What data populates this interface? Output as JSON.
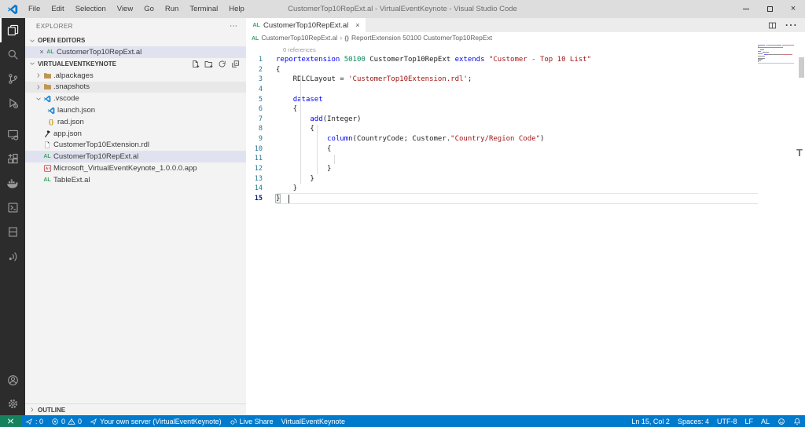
{
  "window": {
    "title": "CustomerTop10RepExt.al - VirtualEventKeynote - Visual Studio Code",
    "menus": [
      "File",
      "Edit",
      "Selection",
      "View",
      "Go",
      "Run",
      "Terminal",
      "Help"
    ],
    "controls": [
      {
        "name": "minimize-button",
        "icon": "minimize-icon"
      },
      {
        "name": "maximize-button",
        "icon": "maximize-icon"
      },
      {
        "name": "close-button",
        "icon": "close-icon"
      }
    ]
  },
  "activity_bar": {
    "top": [
      {
        "name": "explorer",
        "icon": "explorer-icon",
        "active": true
      },
      {
        "name": "search",
        "icon": "search-icon"
      },
      {
        "name": "source-control",
        "icon": "source-control-icon"
      },
      {
        "name": "run-debug",
        "icon": "run-debug-icon"
      },
      {
        "name": "remote-explorer",
        "icon": "remote-explorer-icon"
      },
      {
        "name": "extensions",
        "icon": "extensions-icon"
      },
      {
        "name": "docker",
        "icon": "docker-icon"
      },
      {
        "name": "remote-terminal",
        "icon": "terminal-box-icon"
      },
      {
        "name": "storage",
        "icon": "storage-icon"
      },
      {
        "name": "broadcast",
        "icon": "broadcast-icon"
      }
    ],
    "bottom": [
      {
        "name": "accounts",
        "icon": "account-icon"
      },
      {
        "name": "settings",
        "icon": "gear-icon"
      }
    ]
  },
  "sidebar": {
    "title": "EXPLORER",
    "title_action": "more-icon",
    "open_editors": {
      "label": "OPEN EDITORS",
      "items": [
        {
          "label": "CustomerTop10RepExt.al",
          "icon": "al",
          "selected": true
        }
      ]
    },
    "project": {
      "label": "VIRTUALEVENTKEYNOTE",
      "actions": [
        "new-file-icon",
        "new-folder-icon",
        "refresh-icon",
        "collapse-all-icon"
      ],
      "items": [
        {
          "label": ".alpackages",
          "icon": "folder",
          "type": "folder",
          "chevron": "right",
          "level": 0
        },
        {
          "label": ".snapshots",
          "icon": "folder",
          "type": "folder",
          "chevron": "right",
          "level": 0,
          "state": "hover"
        },
        {
          "label": ".vscode",
          "icon": "vscode",
          "type": "folder",
          "chevron": "down",
          "level": 0
        },
        {
          "label": "launch.json",
          "icon": "vscode",
          "type": "file",
          "level": 1
        },
        {
          "label": "rad.json",
          "icon": "braces",
          "type": "file",
          "level": 1
        },
        {
          "label": "app.json",
          "icon": "axe",
          "type": "file",
          "level": 0
        },
        {
          "label": "CustomerTop10Extension.rdl",
          "icon": "file",
          "type": "file",
          "level": 0
        },
        {
          "label": "CustomerTop10RepExt.al",
          "icon": "al",
          "type": "file",
          "level": 0,
          "state": "selected"
        },
        {
          "label": "Microsoft_VirtualEventKeynote_1.0.0.0.app",
          "icon": "app",
          "type": "file",
          "level": 0
        },
        {
          "label": "TableExt.al",
          "icon": "al",
          "type": "file",
          "level": 0
        }
      ]
    },
    "outline": {
      "label": "OUTLINE"
    }
  },
  "editor": {
    "tab": {
      "label": "CustomerTop10RepExt.al",
      "icon": "al"
    },
    "tab_actions": [
      "split-editor-icon",
      "more-icon"
    ],
    "breadcrumb": [
      {
        "icon": "al",
        "label": "CustomerTop10RepExt.al"
      },
      {
        "icon": "symbol-namespace",
        "label": "ReportExtension 50100 CustomerTop10RepExt"
      }
    ],
    "codelens": "0 references",
    "cursor": {
      "line": 15,
      "col": 2
    },
    "lines": [
      {
        "n": 1,
        "tokens": [
          {
            "t": "reportextension",
            "c": "kw"
          },
          {
            "t": " ",
            "c": "pl"
          },
          {
            "t": "50100",
            "c": "num"
          },
          {
            "t": " CustomerTop10RepExt ",
            "c": "pl"
          },
          {
            "t": "extends",
            "c": "kw"
          },
          {
            "t": " ",
            "c": "pl"
          },
          {
            "t": "\"Customer - Top 10 List\"",
            "c": "str"
          }
        ]
      },
      {
        "n": 2,
        "tokens": [
          {
            "t": "{",
            "c": "pl"
          }
        ]
      },
      {
        "n": 3,
        "tokens": [
          {
            "t": "    RDLCLayout = ",
            "c": "pl"
          },
          {
            "t": "'CustomerTop10Extension.rdl'",
            "c": "str"
          },
          {
            "t": ";",
            "c": "pl"
          }
        ]
      },
      {
        "n": 4,
        "tokens": []
      },
      {
        "n": 5,
        "tokens": [
          {
            "t": "    ",
            "c": "pl"
          },
          {
            "t": "dataset",
            "c": "kw"
          }
        ]
      },
      {
        "n": 6,
        "tokens": [
          {
            "t": "    {",
            "c": "pl"
          }
        ]
      },
      {
        "n": 7,
        "tokens": [
          {
            "t": "        ",
            "c": "pl"
          },
          {
            "t": "add",
            "c": "kw"
          },
          {
            "t": "(Integer)",
            "c": "pl"
          }
        ]
      },
      {
        "n": 8,
        "tokens": [
          {
            "t": "        {",
            "c": "pl"
          }
        ]
      },
      {
        "n": 9,
        "tokens": [
          {
            "t": "            ",
            "c": "pl"
          },
          {
            "t": "column",
            "c": "kw"
          },
          {
            "t": "(CountryCode; Customer.",
            "c": "pl"
          },
          {
            "t": "\"Country/Region Code\"",
            "c": "str"
          },
          {
            "t": ")",
            "c": "pl"
          }
        ]
      },
      {
        "n": 10,
        "tokens": [
          {
            "t": "            {",
            "c": "pl"
          }
        ]
      },
      {
        "n": 11,
        "tokens": []
      },
      {
        "n": 12,
        "tokens": [
          {
            "t": "            }",
            "c": "pl"
          }
        ]
      },
      {
        "n": 13,
        "tokens": [
          {
            "t": "        }",
            "c": "pl"
          }
        ]
      },
      {
        "n": 14,
        "tokens": [
          {
            "t": "    }",
            "c": "pl"
          }
        ]
      },
      {
        "n": 15,
        "tokens": [
          {
            "t": "}",
            "c": "pl",
            "bracket": true
          }
        ],
        "current": true
      }
    ]
  },
  "status_bar": {
    "left": [
      {
        "name": "remote-indicator",
        "parts": [
          {
            "icon": "remote-icon"
          }
        ],
        "remote": true
      },
      {
        "name": "rad-counter",
        "parts": [
          {
            "icon": "plane-icon"
          },
          {
            "text": ": 0"
          }
        ]
      },
      {
        "name": "problems",
        "parts": [
          {
            "icon": "error-circle-icon"
          },
          {
            "text": "0"
          },
          {
            "icon": "warning-triangle-icon"
          },
          {
            "text": "0"
          }
        ]
      },
      {
        "name": "al-server",
        "parts": [
          {
            "icon": "plane-icon"
          },
          {
            "text": "Your own server (VirtualEventKeynote)"
          }
        ]
      },
      {
        "name": "live-share",
        "parts": [
          {
            "icon": "live-share-icon"
          },
          {
            "text": "Live Share"
          }
        ]
      },
      {
        "name": "project-name",
        "parts": [
          {
            "text": "VirtualEventKeynote"
          }
        ]
      }
    ],
    "right": [
      {
        "name": "cursor-position",
        "parts": [
          {
            "text": "Ln 15, Col 2"
          }
        ]
      },
      {
        "name": "indentation",
        "parts": [
          {
            "text": "Spaces: 4"
          }
        ]
      },
      {
        "name": "encoding",
        "parts": [
          {
            "text": "UTF-8"
          }
        ]
      },
      {
        "name": "eol",
        "parts": [
          {
            "text": "LF"
          }
        ]
      },
      {
        "name": "language-mode",
        "parts": [
          {
            "text": "AL"
          }
        ]
      },
      {
        "name": "feedback",
        "parts": [
          {
            "icon": "smiley-icon"
          }
        ]
      },
      {
        "name": "notifications",
        "parts": [
          {
            "icon": "bell-icon"
          }
        ]
      }
    ]
  },
  "colors": {
    "statusbar": "#007ACC",
    "remote_green": "#16825D",
    "activitybar": "#2C2C2C",
    "sidebar": "#F3F3F3",
    "titlebar": "#DDDDDD",
    "selection": "#E0E3EF",
    "keyword": "#0000FF",
    "string": "#A31515",
    "number": "#098658",
    "al_icon_green": "#3FA45F",
    "folder_icon": "#C09553",
    "vscode_icon_blue": "#1E8AD6",
    "braces_icon": "#CB9D27",
    "app_icon_red": "#C0504D",
    "line_number": "#237893"
  }
}
